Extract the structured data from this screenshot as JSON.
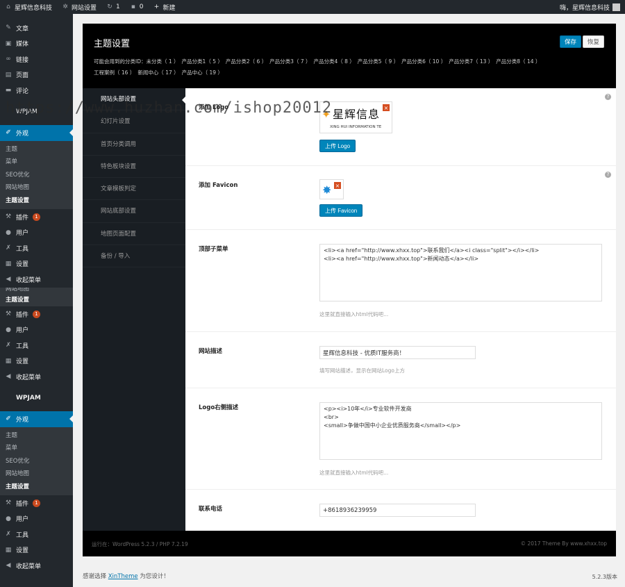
{
  "adminbar": {
    "site_name": "星辉信息科技",
    "site_settings": "网站设置",
    "updates_count": "1",
    "comments_count": "0",
    "new_label": "新建",
    "greeting": "嗨，星辉信息科技"
  },
  "sidebar": {
    "block1": [
      {
        "label": "文章",
        "icon": "pin-icon"
      },
      {
        "label": "媒体",
        "icon": "media-icon"
      },
      {
        "label": "链接",
        "icon": "link-icon"
      },
      {
        "label": "页面",
        "icon": "page-icon"
      },
      {
        "label": "评论",
        "icon": "comment-icon"
      }
    ],
    "wpjam": "WPJAM",
    "appearance": "外观",
    "appearance_sub": [
      "主题",
      "菜单",
      "SEO优化",
      "网站地图",
      "主题设置"
    ],
    "plugins": "插件",
    "plugins_badge": "1",
    "users": "用户",
    "tools": "工具",
    "settings": "设置",
    "collapse": "收起菜单",
    "partial_sub": [
      "网站地图",
      "主题设置"
    ]
  },
  "panel": {
    "title": "主题设置",
    "save": "保存",
    "reset": "恢复",
    "info_prefix": "可能会用到的分类ID：",
    "categories": [
      "未分类（ 1 ）",
      "产品分类1（ 5 ）",
      "产品分类2（ 6 ）",
      "产品分类3（ 7 ）",
      "产品分类4（ 8 ）",
      "产品分类5（ 9 ）",
      "产品分类6（ 10 ）",
      "产品分类7（ 13 ）",
      "产品分类8（ 14 ）",
      "工程案例（ 16 ）",
      "新闻中心（ 17 ）",
      "产品中心（ 19 ）"
    ],
    "tabs": [
      "网站头部设置",
      "幻灯片设置",
      "首页分类调用",
      "特色板块设置",
      "文章模板判定",
      "网站底部设置",
      "地图页面配置",
      "备份 / 导入"
    ]
  },
  "fields": {
    "logo_label": "添加 Logo",
    "logo_text": "星辉信息",
    "logo_sub": "XING HUI INFORMATION TE",
    "upload_logo": "上传 Logo",
    "favicon_label": "添加 Favicon",
    "upload_favicon": "上传 Favicon",
    "topmenu_label": "顶部子菜单",
    "topmenu_value": "<li><a href=\"http://www.xhxx.top\">联系我们</a><i class=\"split\"></i></li>\n<li><a href=\"http://www.xhxx.top\">新闻动态</a></li>",
    "topmenu_desc": "这里就直接输入html代码吧...",
    "sitedesc_label": "网站描述",
    "sitedesc_value": "星辉信息科技 - 优质IT服务商！",
    "sitedesc_desc": "填写网站描述，显示在网站Logo上方",
    "logoright_label": "Logo右侧描述",
    "logoright_value": "<p><i>10年</i>专业软件开发商\n<br>\n<small>争做中国中小企业优质服务商</small></p>",
    "logoright_desc": "这里就直接输入html代码吧...",
    "phone_label": "联系电话",
    "phone_value": "+8618936239959"
  },
  "panel_footer": {
    "left": "运行在：WordPress 5.2.3 / PHP 7.2.19",
    "right": "© 2017 Theme By www.xhxx.top"
  },
  "wp_footer": {
    "thanks_prefix": "感谢选择",
    "theme_link": "XinTheme",
    "thanks_suffix": "为您设计！",
    "version": "5.2.3版本"
  },
  "watermark": "https://www.huzhan.com/ishop20012",
  "colors": {
    "accent": "#0073aa",
    "adminbar": "#23282d",
    "badge": "#ca4a1f",
    "panel": "#000000"
  }
}
